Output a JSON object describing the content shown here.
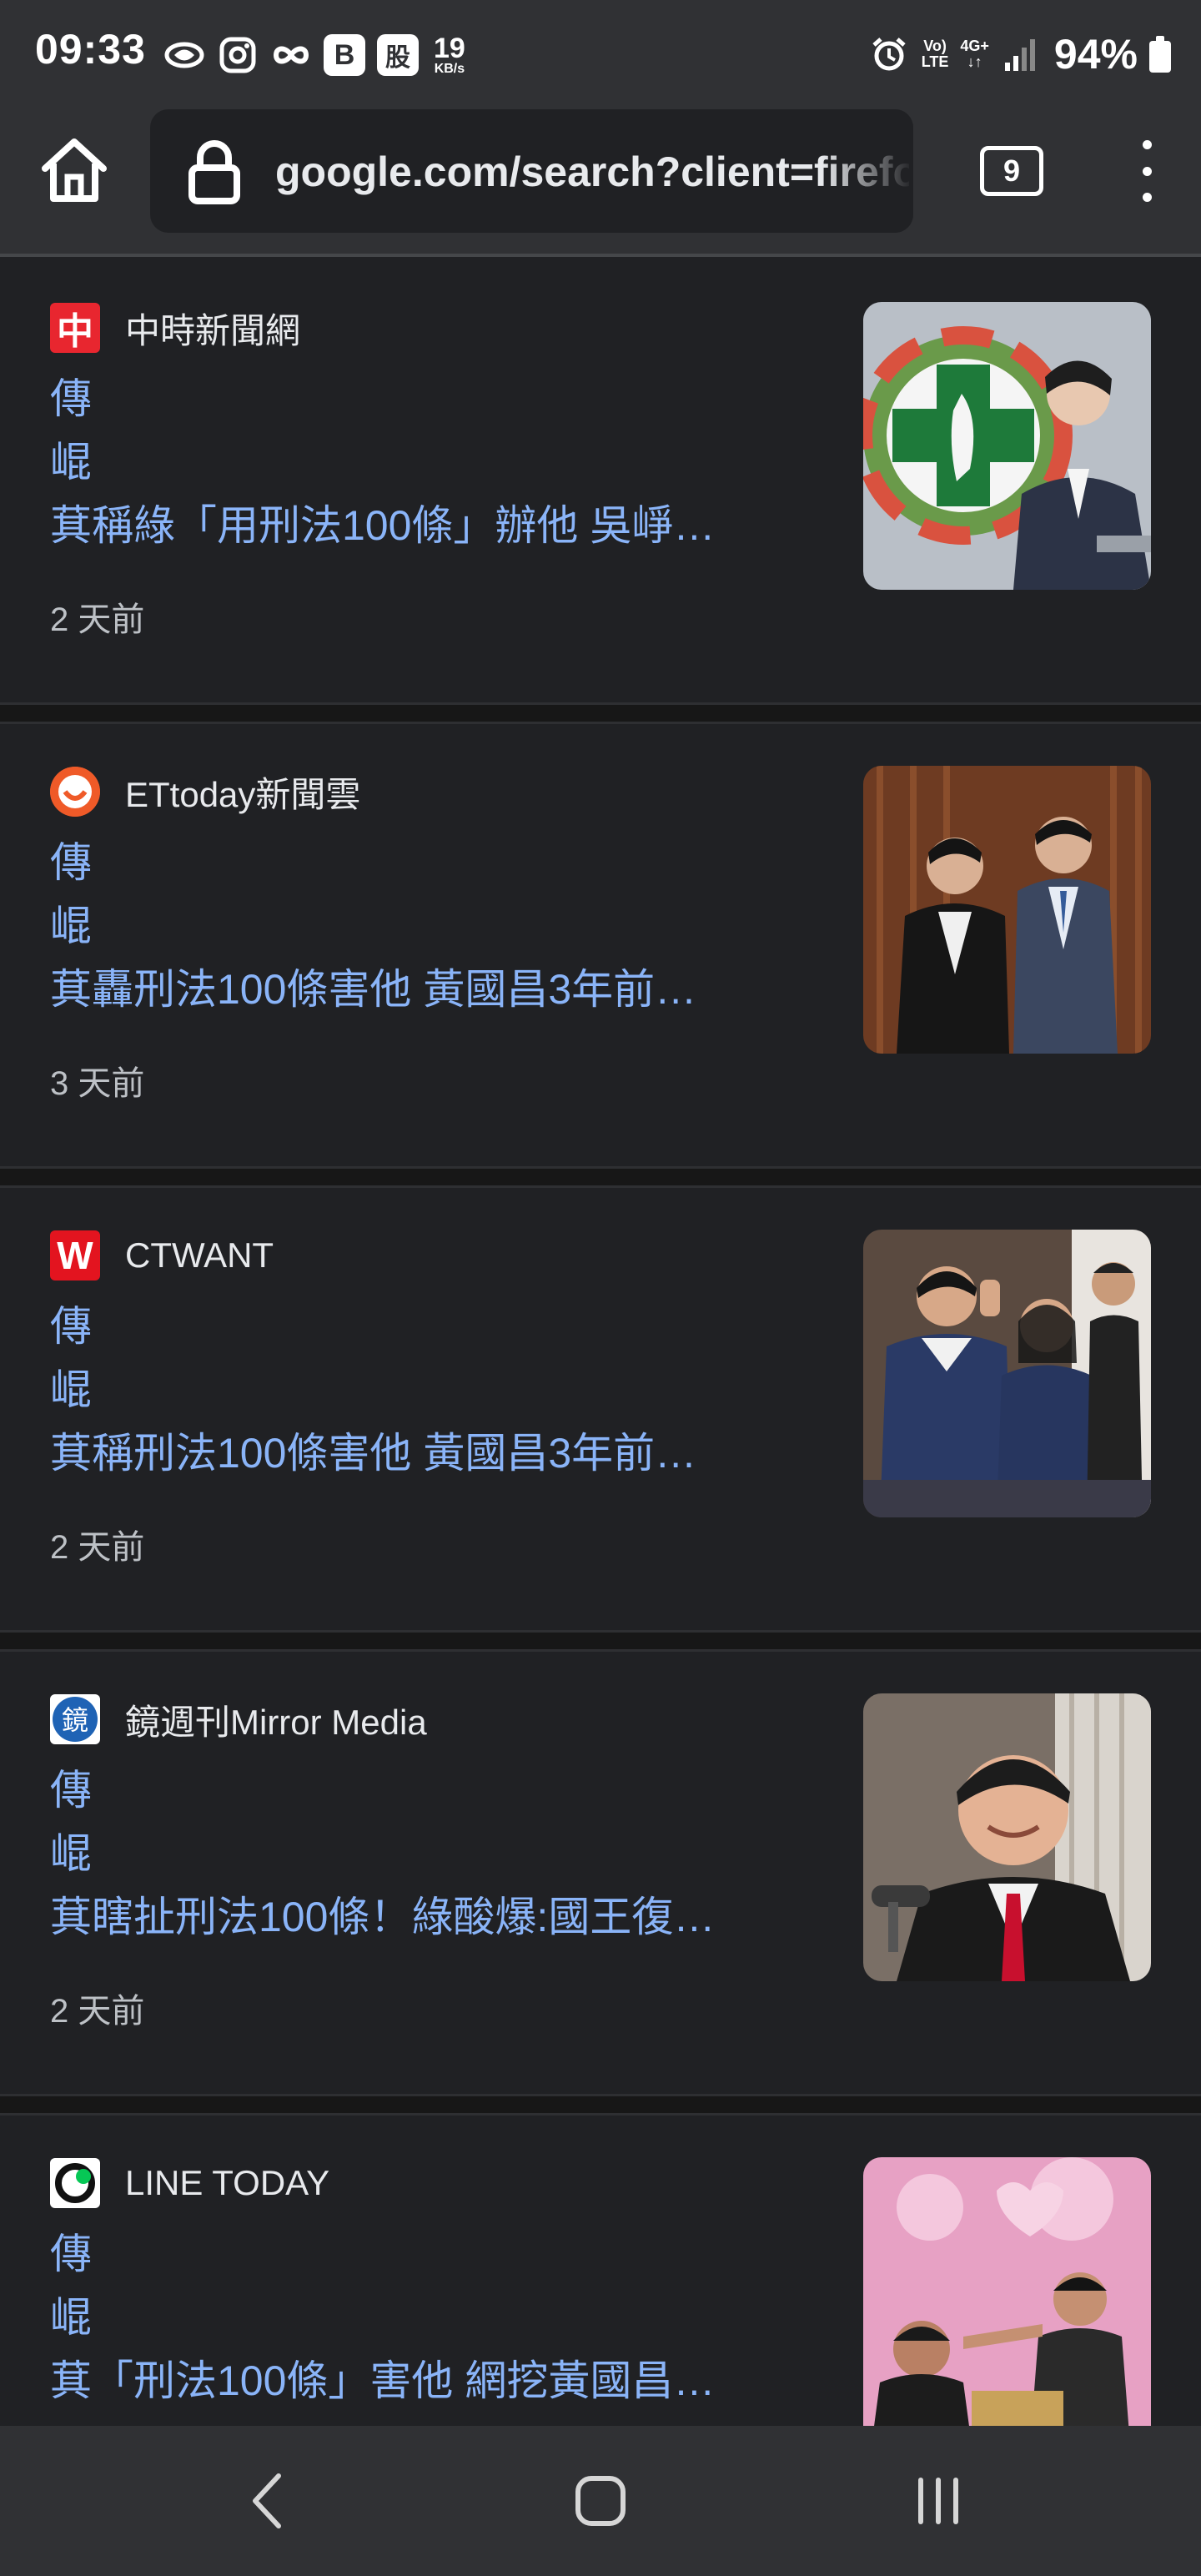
{
  "status_bar": {
    "time": "09:33",
    "badge_b": "B",
    "badge_stock": "股",
    "net_speed": "19",
    "net_speed_unit": "KB/s",
    "volte_top": "Vo)",
    "volte_bottom": "LTE",
    "network_type": "4G+",
    "battery": "94%"
  },
  "toolbar": {
    "url": "google.com/search?client=firefox",
    "tab_count": "9"
  },
  "results": [
    {
      "source": "中時新聞網",
      "favicon_color": "#e8262f",
      "favicon_glyph": "中",
      "headline_lines": [
        "傳",
        "崐",
        "萁稱綠「用刑法100條」辦他 吳崢…"
      ],
      "time": "2 天前"
    },
    {
      "source": "ETtoday新聞雲",
      "favicon_color": "#ef5a28",
      "favicon_glyph": "",
      "headline_lines": [
        "傳",
        "崐",
        "萁轟刑法100條害他 黃國昌3年前…"
      ],
      "time": "3 天前"
    },
    {
      "source": "CTWANT",
      "favicon_color": "#e3141f",
      "favicon_glyph": "W",
      "headline_lines": [
        "傳",
        "崐",
        "萁稱刑法100條害他 黃國昌3年前…"
      ],
      "time": "2 天前"
    },
    {
      "source": "鏡週刊Mirror Media",
      "favicon_color": "#1f63b5",
      "favicon_glyph": "鏡",
      "headline_lines": [
        "傳",
        "崐",
        "萁瞎扯刑法100條！綠酸爆:國王復…"
      ],
      "time": "2 天前"
    },
    {
      "source": "LINE TODAY",
      "favicon_color": "#ffffff",
      "favicon_glyph": "",
      "headline_lines": [
        "傳",
        "崐",
        "萁「刑法100條」害他 網挖黃國昌…"
      ],
      "time": ""
    }
  ],
  "colors": {
    "link": "#8ab4f8",
    "background": "#202124",
    "chrome": "#303134"
  }
}
